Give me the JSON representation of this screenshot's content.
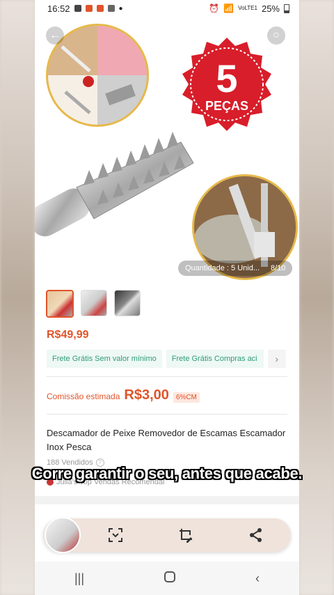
{
  "status_bar": {
    "time": "16:52",
    "network": "VoLTE1",
    "battery": "25%"
  },
  "product": {
    "badge_number": "5",
    "badge_label": "PEÇAS",
    "quantity_label": "Quantidade : 5 Unid...",
    "image_counter": "8/10",
    "price": "R$49,99",
    "shipping_chips": [
      "Frete Grátis Sem valor mínimo",
      "Frete Grátis Compras aci"
    ],
    "commission_label": "Comissão estimada",
    "commission_value": "R$3,00",
    "commission_tag": "6%CM",
    "title": "Descamador de Peixe Removedor de Escamas Escamador Inox Pesca",
    "sold": "188 Vendidos",
    "seller": "Julia's Top Vendas Recomendai"
  },
  "subtitle": "Corre garantir o seu, antes que acabe.",
  "colors": {
    "accent": "#e0542a",
    "shipping_green": "#2e9c7a",
    "badge_red": "#d81e2a"
  }
}
